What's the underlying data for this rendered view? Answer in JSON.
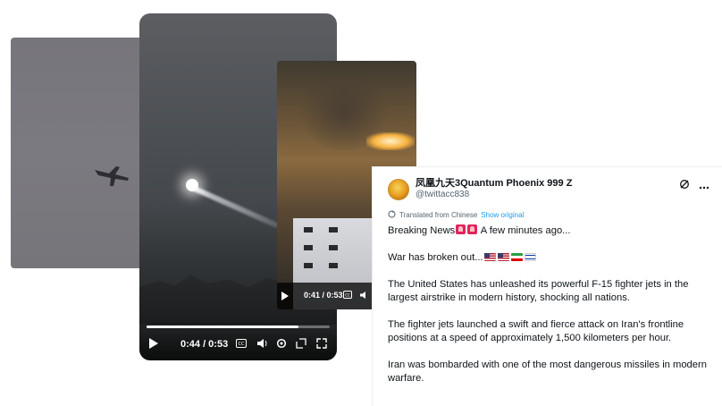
{
  "media": {
    "jet_photo": {
      "icon": "fighter-jet-silhouette"
    },
    "missile_video": {
      "time": "0:44 / 0:53",
      "progress": 0.83,
      "controls": [
        "play-icon",
        "cc-icon",
        "volume-icon",
        "settings-icon",
        "miniplayer-icon",
        "fullscreen-icon"
      ]
    },
    "explosion_video": {
      "time": "0:41 / 0:53",
      "controls": [
        "play-icon",
        "cc-icon",
        "volume-icon"
      ]
    }
  },
  "tweet": {
    "display_name": "凤凰九天3Quantum Phoenix 999 Z",
    "handle": "@twittacc838",
    "translated_label": "Translated from Chinese",
    "show_original": "Show original",
    "line1_text": "Breaking News",
    "line1_tail": "A few minutes ago...",
    "line2_text": "War has broken out...",
    "para3": "The United States has unleashed its powerful F-15 fighter jets in the largest airstrike in modern history, shocking all nations.",
    "para4": "The fighter jets launched a swift and fierce attack on Iran's frontline positions at a speed of approximately 1,500 kilometers per hour.",
    "para5": "Iran was bombarded with one of the most dangerous missiles in modern warfare.",
    "colors": {
      "link": "#1d9bf0",
      "secondary": "#536471",
      "text": "#0f1419"
    }
  }
}
